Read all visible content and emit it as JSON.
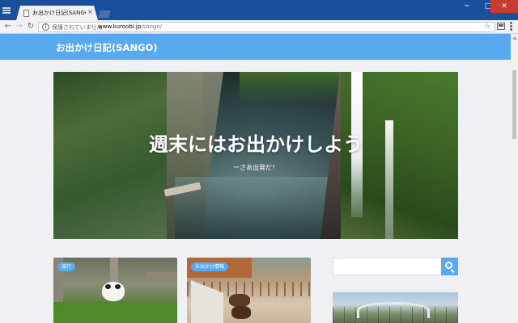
{
  "browser": {
    "tab_title": "お出かけ日記(SANGO) | おで",
    "tab_close": "×",
    "security_label": "保護されていません",
    "url_host": "www.kuroobi.jp",
    "url_path": "/sango/",
    "window_minimize": "─",
    "window_maximize": "□",
    "window_close": "✕",
    "nav_back": "←",
    "nav_forward": "→",
    "nav_reload": "↻",
    "bookmark_star": "☆",
    "info_icon": "i"
  },
  "site": {
    "title": "お出かけ日記(SANGO)",
    "header_color": "#58a9ef"
  },
  "hero": {
    "headline": "週末にはお出かけしよう",
    "subtitle": "ーさあ出発だ！"
  },
  "posts": [
    {
      "category": "旅行"
    },
    {
      "category": "お出かけ情報"
    }
  ],
  "sidebar": {
    "search_placeholder": ""
  }
}
